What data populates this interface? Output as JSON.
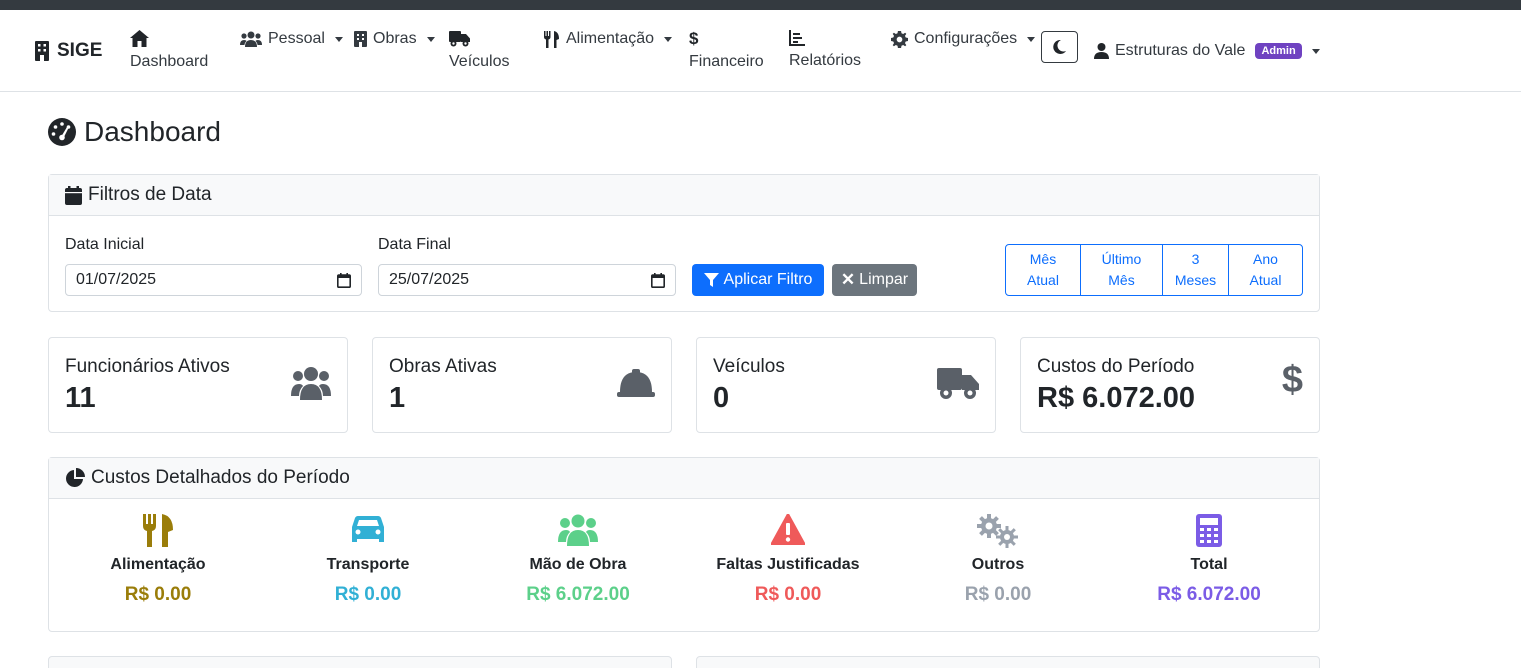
{
  "nav": {
    "brand": "SIGE",
    "dashboard": "Dashboard",
    "pessoal": "Pessoal",
    "obras": "Obras",
    "veiculos": "Veículos",
    "alimentacao": "Alimentação",
    "financeiro": "Financeiro",
    "relatorios": "Relatórios",
    "configuracoes": "Configurações",
    "user": "Estruturas do Vale",
    "user_badge": "Admin"
  },
  "page": {
    "title": "Dashboard"
  },
  "filters": {
    "title": "Filtros de Data",
    "start_label": "Data Inicial",
    "start_value": "01/07/2025",
    "end_label": "Data Final",
    "end_value": "25/07/2025",
    "apply": "Aplicar Filtro",
    "clear": "Limpar",
    "presets": [
      {
        "line1": "Mês",
        "line2": "Atual"
      },
      {
        "line1": "Último",
        "line2": "Mês"
      },
      {
        "line1": "3",
        "line2": "Meses"
      },
      {
        "line1": "Ano",
        "line2": "Atual"
      }
    ]
  },
  "stats": [
    {
      "title": "Funcionários Ativos",
      "value": "11",
      "icon": "users-icon"
    },
    {
      "title": "Obras Ativas",
      "value": "1",
      "icon": "hard-hat-icon"
    },
    {
      "title": "Veículos",
      "value": "0",
      "icon": "truck-icon"
    },
    {
      "title": "Custos do Período",
      "value": "R$ 6.072.00",
      "icon": "dollar-icon"
    }
  ],
  "costs": {
    "title": "Custos Detalhados do Período",
    "items": [
      {
        "label": "Alimentação",
        "value": "R$ 0.00",
        "color": "#9a7d0a",
        "icon": "utensils-icon"
      },
      {
        "label": "Transporte",
        "value": "R$ 0.00",
        "color": "#31b0d5",
        "icon": "car-icon"
      },
      {
        "label": "Mão de Obra",
        "value": "R$ 6.072.00",
        "color": "#5cd08a",
        "icon": "users-icon"
      },
      {
        "label": "Faltas Justificadas",
        "value": "R$ 0.00",
        "color": "#ef5a5a",
        "icon": "warning-icon"
      },
      {
        "label": "Outros",
        "value": "R$ 0.00",
        "color": "#9aa2ad",
        "icon": "gears-icon"
      },
      {
        "label": "Total",
        "value": "R$ 6.072.00",
        "color": "#7b5ce6",
        "icon": "calculator-icon"
      }
    ]
  }
}
